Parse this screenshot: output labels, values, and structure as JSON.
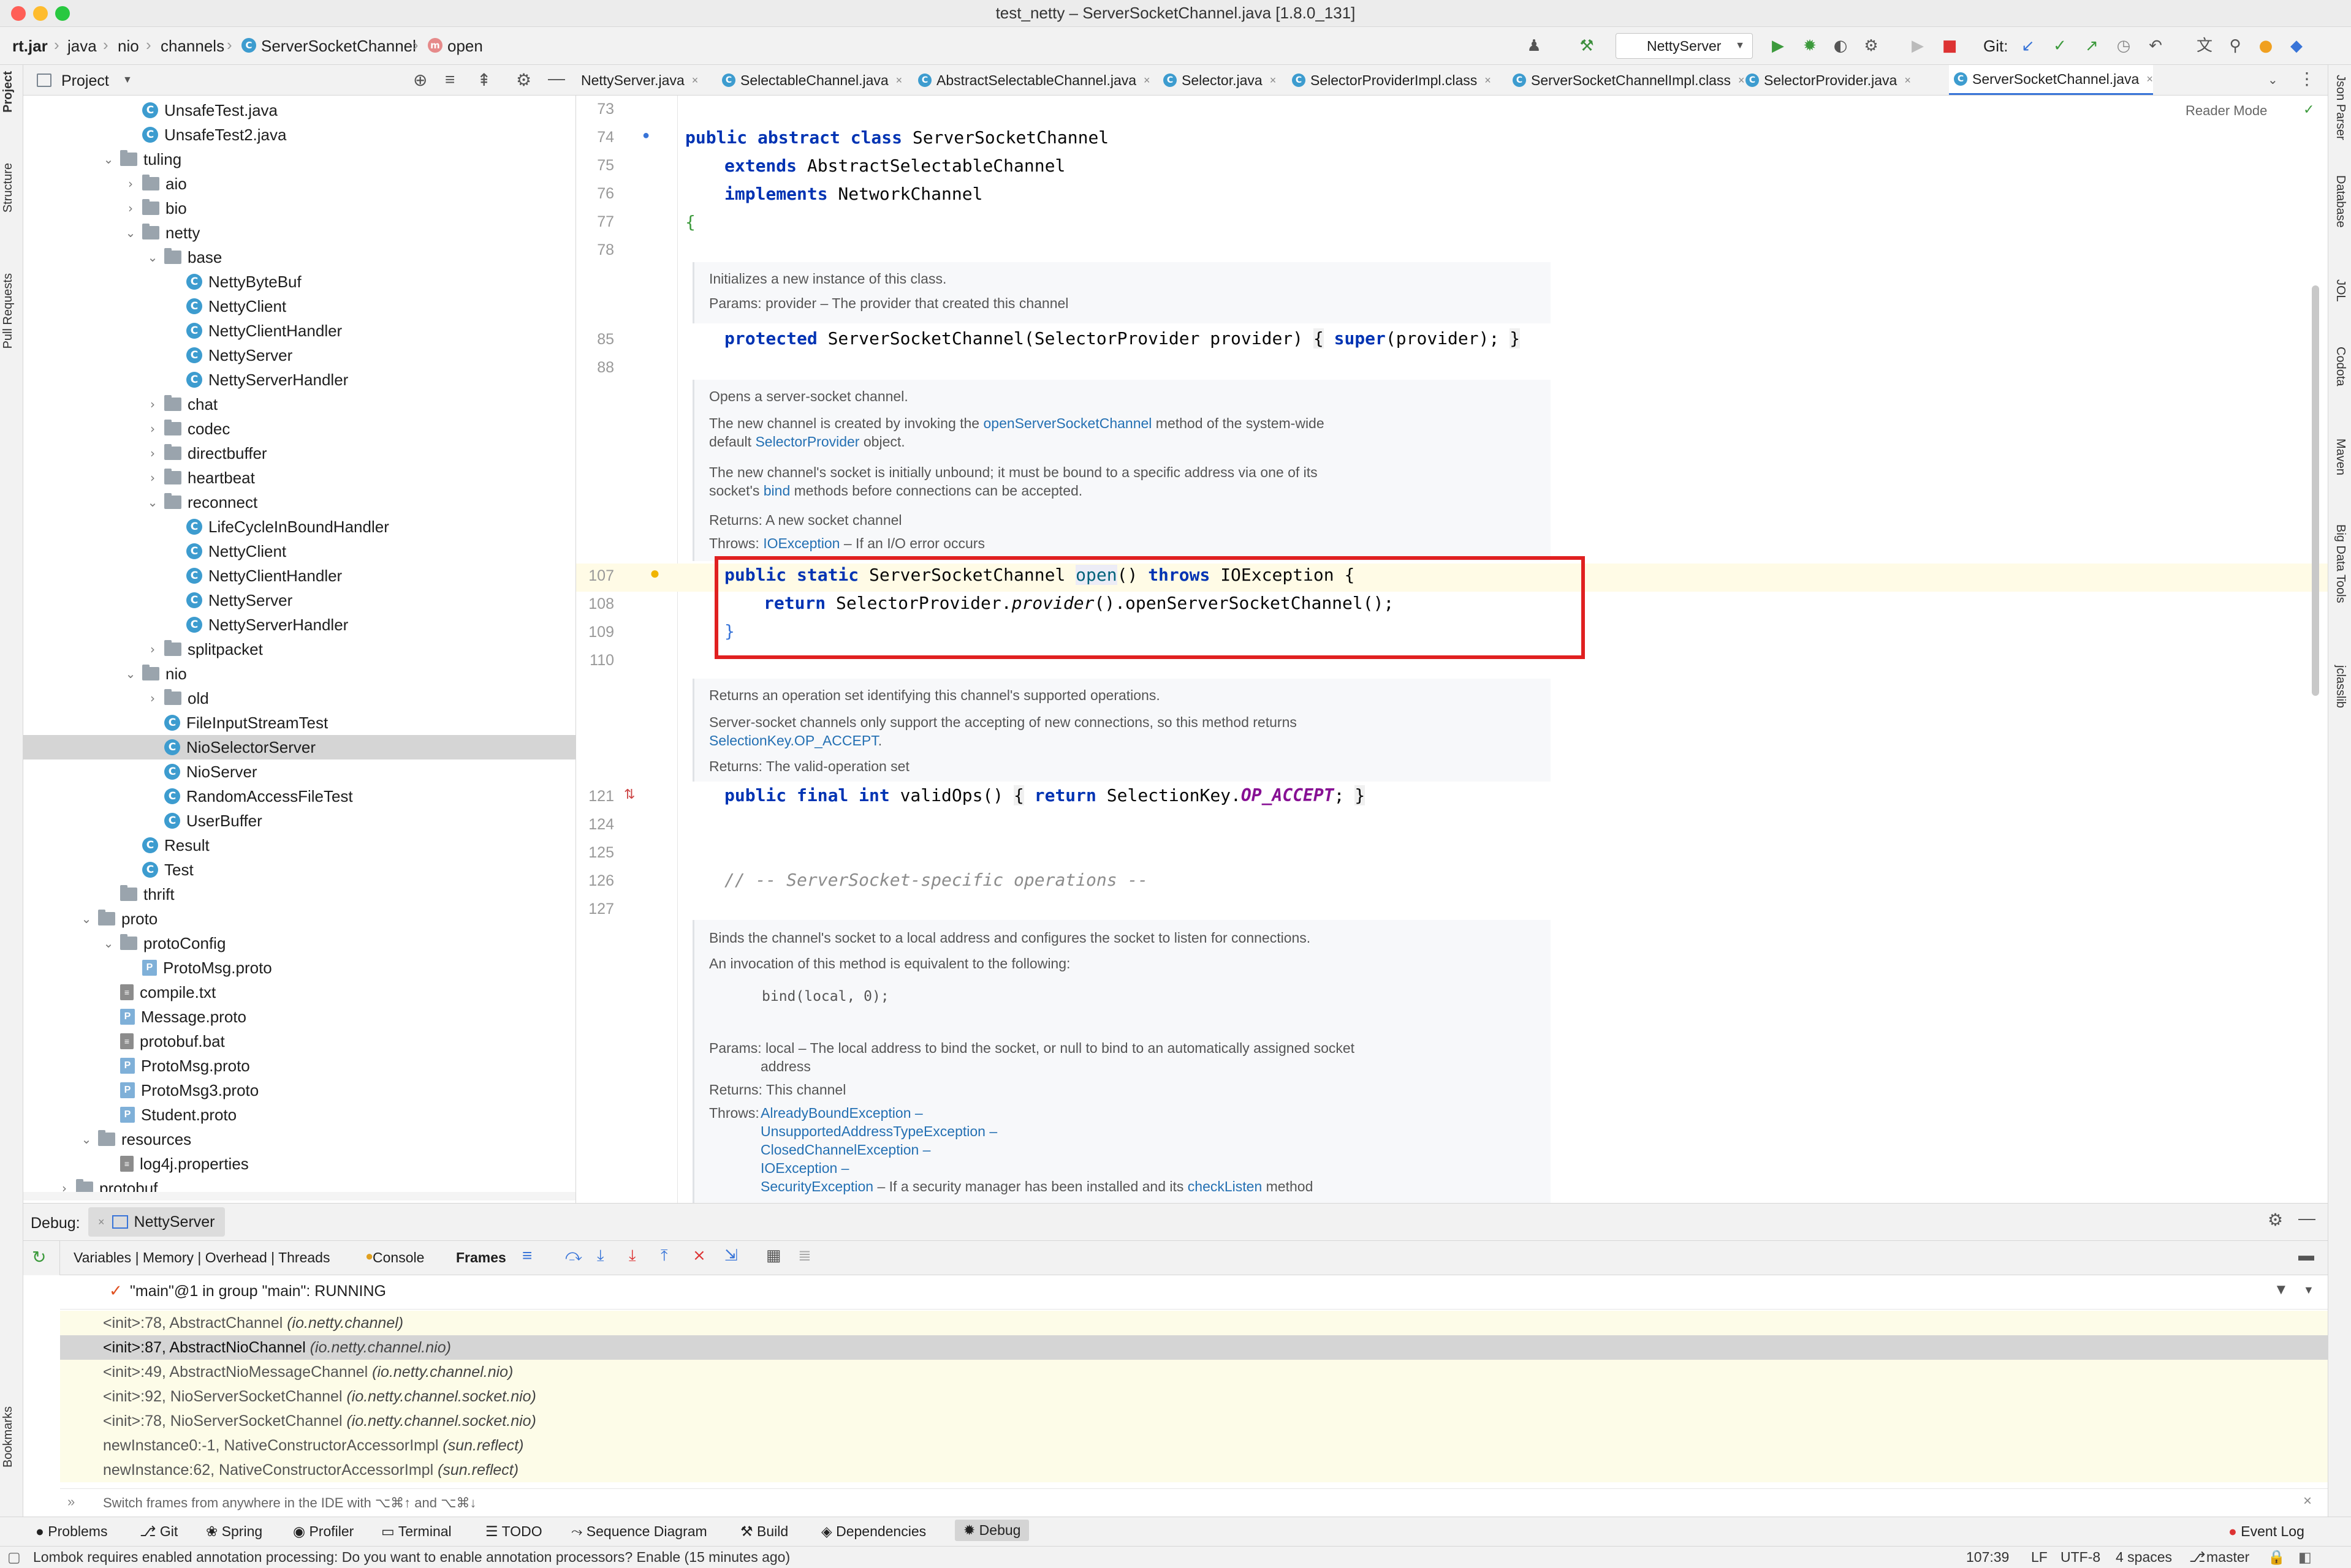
{
  "window": {
    "title": "test_netty – ServerSocketChannel.java [1.8.0_131]"
  },
  "breadcrumb": [
    "rt.jar",
    "java",
    "nio",
    "channels",
    "ServerSocketChannel",
    "open"
  ],
  "toolbar": {
    "run_config": "NettyServer",
    "git_label": "Git:"
  },
  "project_panel": {
    "title": "Project"
  },
  "tree": [
    {
      "label": "UnsafeTest.java",
      "type": "file",
      "indent": 4
    },
    {
      "label": "UnsafeTest2.java",
      "type": "file",
      "indent": 4
    },
    {
      "label": "tuling",
      "type": "folder",
      "indent": 3,
      "open": true
    },
    {
      "label": "aio",
      "type": "folder",
      "indent": 4,
      "open": false
    },
    {
      "label": "bio",
      "type": "folder",
      "indent": 4,
      "open": false
    },
    {
      "label": "netty",
      "type": "folder",
      "indent": 4,
      "open": true
    },
    {
      "label": "base",
      "type": "folder",
      "indent": 5,
      "open": true
    },
    {
      "label": "NettyByteBuf",
      "type": "class",
      "indent": 6
    },
    {
      "label": "NettyClient",
      "type": "class",
      "indent": 6
    },
    {
      "label": "NettyClientHandler",
      "type": "class",
      "indent": 6
    },
    {
      "label": "NettyServer",
      "type": "class",
      "indent": 6
    },
    {
      "label": "NettyServerHandler",
      "type": "class",
      "indent": 6
    },
    {
      "label": "chat",
      "type": "folder",
      "indent": 5,
      "open": false
    },
    {
      "label": "codec",
      "type": "folder",
      "indent": 5,
      "open": false
    },
    {
      "label": "directbuffer",
      "type": "folder",
      "indent": 5,
      "open": false
    },
    {
      "label": "heartbeat",
      "type": "folder",
      "indent": 5,
      "open": false
    },
    {
      "label": "reconnect",
      "type": "folder",
      "indent": 5,
      "open": true
    },
    {
      "label": "LifeCycleInBoundHandler",
      "type": "class",
      "indent": 6
    },
    {
      "label": "NettyClient",
      "type": "class",
      "indent": 6
    },
    {
      "label": "NettyClientHandler",
      "type": "class",
      "indent": 6
    },
    {
      "label": "NettyServer",
      "type": "class",
      "indent": 6
    },
    {
      "label": "NettyServerHandler",
      "type": "class",
      "indent": 6
    },
    {
      "label": "splitpacket",
      "type": "folder",
      "indent": 5,
      "open": false
    },
    {
      "label": "nio",
      "type": "folder",
      "indent": 4,
      "open": true
    },
    {
      "label": "old",
      "type": "folder",
      "indent": 5,
      "open": false
    },
    {
      "label": "FileInputStreamTest",
      "type": "class",
      "indent": 5
    },
    {
      "label": "NioSelectorServer",
      "type": "class",
      "indent": 5,
      "selected": true
    },
    {
      "label": "NioServer",
      "type": "class",
      "indent": 5
    },
    {
      "label": "RandomAccessFileTest",
      "type": "class",
      "indent": 5
    },
    {
      "label": "UserBuffer",
      "type": "class",
      "indent": 5
    },
    {
      "label": "Result",
      "type": "class",
      "indent": 4
    },
    {
      "label": "Test",
      "type": "class",
      "indent": 4
    },
    {
      "label": "thrift",
      "type": "folder",
      "indent": 3,
      "leaf": true
    },
    {
      "label": "proto",
      "type": "folder",
      "indent": 2,
      "open": true
    },
    {
      "label": "protoConfig",
      "type": "folder",
      "indent": 3,
      "open": true
    },
    {
      "label": "ProtoMsg.proto",
      "type": "proto",
      "indent": 4
    },
    {
      "label": "compile.txt",
      "type": "text",
      "indent": 3
    },
    {
      "label": "Message.proto",
      "type": "proto",
      "indent": 3
    },
    {
      "label": "protobuf.bat",
      "type": "text",
      "indent": 3
    },
    {
      "label": "ProtoMsg.proto",
      "type": "proto",
      "indent": 3
    },
    {
      "label": "ProtoMsg3.proto",
      "type": "proto",
      "indent": 3
    },
    {
      "label": "Student.proto",
      "type": "proto",
      "indent": 3
    },
    {
      "label": "resources",
      "type": "folder",
      "indent": 2,
      "open": true
    },
    {
      "label": "log4j.properties",
      "type": "text",
      "indent": 3
    },
    {
      "label": "protobuf",
      "type": "folder",
      "indent": 1,
      "open": false
    }
  ],
  "editor_tabs": [
    "NettyServer.java",
    "SelectableChannel.java",
    "AbstractSelectableChannel.java",
    "Selector.java",
    "SelectorProviderImpl.class",
    "SelectorProviderImpl.class",
    "ServerSocketChannelImpl.class",
    "SelectorProvider.java",
    "ServerSocketChannel.java"
  ],
  "reader_mode": "Reader Mode",
  "code": {
    "l73": "73",
    "l74": "74",
    "l75": "75",
    "l76": "76",
    "l77": "77",
    "l78": "78",
    "l85": "85",
    "l88": "88",
    "l107": "107",
    "l108": "108",
    "l109": "109",
    "l110": "110",
    "l121": "121",
    "l124": "124",
    "l125": "125",
    "l126": "126",
    "l127": "127",
    "doc1": [
      "Initializes a new instance of this class.",
      "Params: provider – The provider that created this channel"
    ],
    "doc2": {
      "a": "Opens a server-socket channel.",
      "b1": "The new channel is created by invoking the ",
      "b_link": "openServerSocketChannel",
      "b2": " method of the system-wide",
      "c1": "default ",
      "c_link": "SelectorProvider",
      "c2": " object.",
      "d": "The new channel's socket is initially unbound; it must be bound to a specific address via one of its",
      "e1": "socket's ",
      "e_link": "bind",
      "e2": " methods before connections can be accepted.",
      "f": "Returns: A new socket channel",
      "g1": "Throws: ",
      "g_link": "IOException",
      "g2": " – If an I/O error occurs"
    },
    "doc3": {
      "a": "Returns an operation set identifying this channel's supported operations.",
      "b": "Server-socket channels only support the accepting of new connections, so this method returns",
      "c_link": "SelectionKey.OP_ACCEPT",
      "c2": ".",
      "d": "Returns: The valid-operation set"
    },
    "comment": "// -- ServerSocket-specific operations --",
    "doc4": {
      "a": "Binds the channel's socket to a local address and configures the socket to listen for connections.",
      "b": "An invocation of this method is equivalent to the following:",
      "c": "bind(local, 0);",
      "d": "Params:  local – The local address to bind the socket, or null to bind to an automatically assigned socket",
      "e": "address",
      "f": "Returns:  This channel",
      "g": "Throws:",
      "h": [
        "AlreadyBoundException –",
        "UnsupportedAddressTypeException –",
        "ClosedChannelException –",
        "IOException –",
        "SecurityException"
      ],
      "i": " – If a security manager has been installed and its ",
      "j": "checkListen",
      "k": " method"
    }
  },
  "debug": {
    "label": "Debug:",
    "config": "NettyServer",
    "tabs": [
      "Variables | Memory | Overhead | Threads",
      "Console",
      "Frames"
    ],
    "thread": "\"main\"@1 in group \"main\": RUNNING",
    "frames": [
      {
        "m": "<init>:78, AbstractChannel ",
        "p": "(io.netty.channel)"
      },
      {
        "m": "<init>:87, AbstractNioChannel ",
        "p": "(io.netty.channel.nio)",
        "selected": true
      },
      {
        "m": "<init>:49, AbstractNioMessageChannel ",
        "p": "(io.netty.channel.nio)"
      },
      {
        "m": "<init>:92, NioServerSocketChannel ",
        "p": "(io.netty.channel.socket.nio)"
      },
      {
        "m": "<init>:78, NioServerSocketChannel ",
        "p": "(io.netty.channel.socket.nio)"
      },
      {
        "m": "newInstance0:-1, NativeConstructorAccessorImpl ",
        "p": "(sun.reflect)"
      },
      {
        "m": "newInstance:62, NativeConstructorAccessorImpl ",
        "p": "(sun.reflect)"
      }
    ],
    "hint": "Switch frames from anywhere in the IDE with ⌥⌘↑ and ⌥⌘↓"
  },
  "tool_windows": [
    "Problems",
    "Git",
    "Spring",
    "Profiler",
    "Terminal",
    "TODO",
    "Sequence Diagram",
    "Build",
    "Dependencies",
    "Debug"
  ],
  "event_log": "Event Log",
  "left_tabs": [
    "Project",
    "Structure",
    "Pull Requests",
    "Bookmarks"
  ],
  "right_tabs": [
    "Json Parser",
    "Database",
    "JOL",
    "Codota",
    "Maven",
    "Big Data Tools",
    "jclasslib"
  ],
  "status": {
    "message": "Lombok requires enabled annotation processing: Do you want to enable annotation processors? Enable (15 minutes ago)",
    "position": "107:39",
    "line_sep": "LF",
    "encoding": "UTF-8",
    "indent": "4 spaces",
    "branch": "master"
  },
  "colors": {
    "highlight_box": "#e02020",
    "selection": "#3874d8",
    "current_line": "#fffbe6"
  }
}
